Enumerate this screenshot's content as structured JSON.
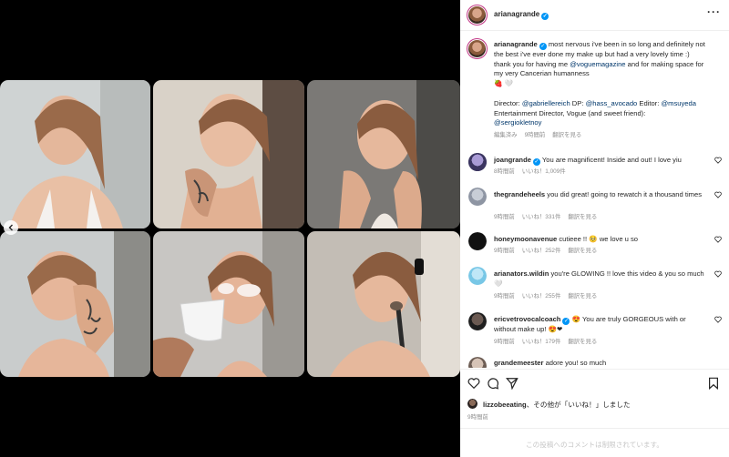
{
  "post": {
    "author": "arianagrande",
    "caption_user": "arianagrande",
    "caption_lines": [
      "most nervous i've been in so long and definitely",
      "not the best i've ever done my make up but had a very lovely",
      "time :) thank you for having me",
      "and for",
      "making space for my very Cancerian humanness"
    ],
    "caption_mention": "@voguemagazine",
    "caption_emoji": "🍓 🤍",
    "credits_line1_prefix": "Director: ",
    "credits_director": "@gabriellereich",
    "credits_dp_prefix": " DP: ",
    "credits_dp": "@hass_avocado",
    "credits_editor_prefix": " Editor: ",
    "credits_editor": "@msuyeda",
    "credits_line2": "Entertainment Director, Vogue (and sweet friend):",
    "credits_friend": "@sergiokletnoy",
    "meta_edited": "編集済み",
    "meta_time": "9時間前",
    "meta_translate": "翻訳を見る"
  },
  "comments": [
    {
      "user": "joangrande",
      "verified": true,
      "text": "You are magnificent! Inside and out! I love yiu",
      "time": "8時間前",
      "likes": "いいね！1,009件",
      "reply": ""
    },
    {
      "user": "thegrandeheels",
      "verified": false,
      "text": "you did great! going to rewatch it a thousand",
      "text2": "times",
      "time": "9時間前",
      "likes": "いいね！331件",
      "reply": "翻訳を見る"
    },
    {
      "user": "honeymoonavenue",
      "verified": false,
      "text": "cutieee !! 🥺 we love u so",
      "time": "9時間前",
      "likes": "いいね！252件",
      "reply": "翻訳を見る"
    },
    {
      "user": "arianators.wildin",
      "verified": false,
      "text": "you're GLOWING !! love this video & you so",
      "text2": "much 🤍",
      "time": "9時間前",
      "likes": "いいね！255件",
      "reply": "翻訳を見る"
    },
    {
      "user": "ericvetrovocalcoach",
      "verified": true,
      "text": "😍 You are truly GORGEOUS with or",
      "text2": "without make up! 😍❤",
      "time": "9時間前",
      "likes": "いいね！179件",
      "reply": "翻訳を見る"
    },
    {
      "user": "grandemeester",
      "verified": false,
      "text": "adore you! so much",
      "time": "",
      "likes": "",
      "reply": ""
    }
  ],
  "likes": {
    "user": "lizzobeeating",
    "text": "、その他が「いいね！」しました",
    "time": "9時間前"
  },
  "footer": {
    "comments_disabled": "この投稿へのコメントは制限されています。"
  },
  "header": {
    "more_label": "···"
  },
  "colors": {
    "verified": "#0095f6",
    "link": "#00376b",
    "muted": "#8e8e8e",
    "ring": "#c13584"
  },
  "icons": [
    "heart-icon",
    "comment-icon",
    "share-icon",
    "bookmark-icon",
    "more-icon",
    "chevron-left-icon",
    "verified-icon"
  ]
}
